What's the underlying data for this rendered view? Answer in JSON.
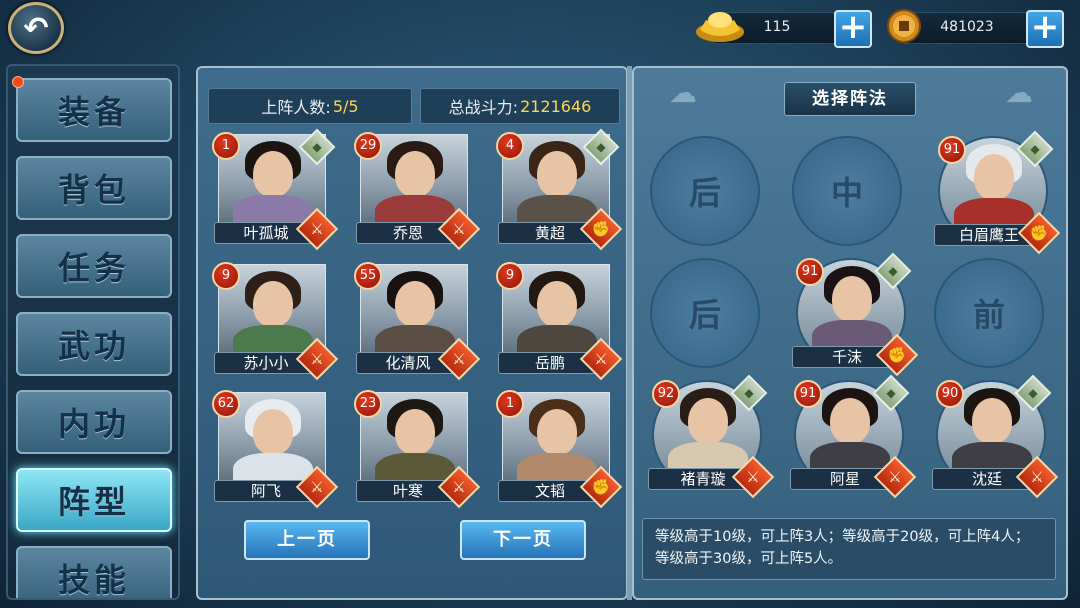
{
  "resources": {
    "gold": {
      "icon": "gold-ingot-icon",
      "value": "115"
    },
    "coins": {
      "icon": "coin-icon",
      "value": "481023"
    }
  },
  "sidebar": {
    "items": [
      {
        "label": "装备",
        "active": false
      },
      {
        "label": "背包",
        "active": false
      },
      {
        "label": "任务",
        "active": false
      },
      {
        "label": "武功",
        "active": false
      },
      {
        "label": "内功",
        "active": false
      },
      {
        "label": "阵型",
        "active": true
      },
      {
        "label": "技能",
        "active": false
      }
    ]
  },
  "left_panel": {
    "deployed_label": "上阵人数:",
    "deployed_value": "5/5",
    "power_label": "总战斗力:",
    "power_value": "2121646",
    "heroes": [
      {
        "name": "叶孤城",
        "level": "1",
        "class": "sword",
        "element": true
      },
      {
        "name": "乔恩",
        "level": "29",
        "class": "sword",
        "element": false
      },
      {
        "name": "黄超",
        "level": "4",
        "class": "fist",
        "element": true
      },
      {
        "name": "苏小小",
        "level": "9",
        "class": "sword",
        "element": false
      },
      {
        "name": "化清风",
        "level": "55",
        "class": "sword",
        "element": false
      },
      {
        "name": "岳鹏",
        "level": "9",
        "class": "sword",
        "element": false
      },
      {
        "name": "阿飞",
        "level": "62",
        "class": "sword",
        "element": false
      },
      {
        "name": "叶寒",
        "level": "23",
        "class": "sword",
        "element": false
      },
      {
        "name": "文韬",
        "level": "1",
        "class": "fist",
        "element": false
      }
    ],
    "prev_page": "上一页",
    "next_page": "下一页"
  },
  "right_panel": {
    "title": "选择阵法",
    "empty_slots": [
      {
        "label": "后"
      },
      {
        "label": "中"
      },
      {
        "label": "后"
      },
      {
        "label": "前"
      }
    ],
    "slot_heroes": [
      {
        "name": "白眉鹰王",
        "level": "91",
        "class": "fist"
      },
      {
        "name": "千沫",
        "level": "91",
        "class": "fist"
      },
      {
        "name": "褚青璇",
        "level": "92",
        "class": "sword"
      },
      {
        "name": "阿星",
        "level": "91",
        "class": "sword"
      },
      {
        "name": "沈廷",
        "level": "90",
        "class": "sword"
      }
    ],
    "description": "等级高于10级，可上阵3人；等级高于20级，可上阵4人；等级高于30级，可上阵5人。"
  }
}
